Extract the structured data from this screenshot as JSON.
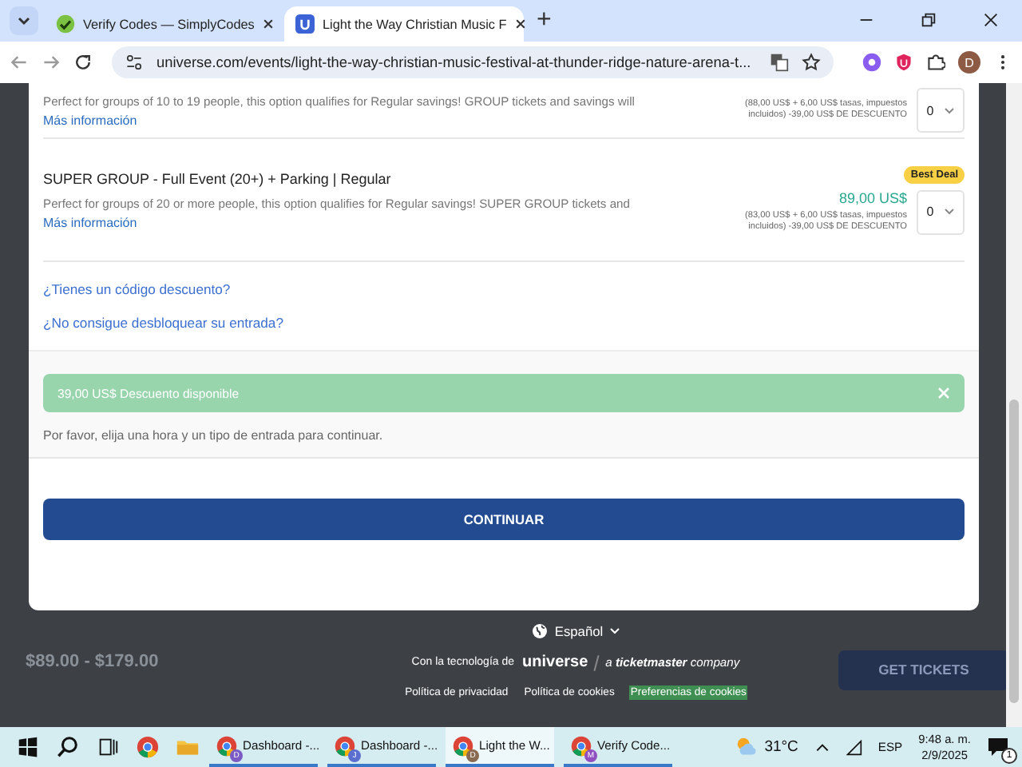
{
  "browser": {
    "tabs": [
      {
        "title": "Verify Codes — SimplyCodes",
        "selected": false
      },
      {
        "title": "Light the Way Christian Music F",
        "selected": true
      }
    ],
    "new_tab": "+",
    "url": "universe.com/events/light-the-way-christian-music-festival-at-thunder-ridge-nature-arena-t...",
    "profile": "D"
  },
  "tickets": [
    {
      "description": "Perfect for groups of 10 to 19 people, this option qualifies for Regular savings! GROUP tickets and savings will",
      "more_link": "Más información",
      "detail_lines": [
        "(88,00 US$ + 6,00 US$ tasas, impuestos",
        "incluidos) -39,00 US$ DE DESCUENTO"
      ],
      "quantity": "0"
    },
    {
      "title": "SUPER GROUP - Full Event (20+) + Parking | Regular",
      "description": "Perfect for groups of 20 or more people, this option qualifies for Regular savings! SUPER GROUP tickets and",
      "more_link": "Más información",
      "badge": "Best Deal",
      "price": "89,00 US$",
      "detail_lines": [
        "(83,00 US$ + 6,00 US$ tasas, impuestos",
        "incluidos) -39,00 US$ DE DESCUENTO"
      ],
      "quantity": "0"
    }
  ],
  "links": [
    "¿Tienes un código descuento?",
    "¿No consigue desbloquear su entrada?"
  ],
  "discount_banner": "39,00 US$ Descuento disponible",
  "notice": "Por favor, elija una hora y un tipo de entrada para continuar.",
  "continue_button": "CONTINUAR",
  "footer": {
    "language": "Español",
    "powered_by": "Con la tecnología de",
    "brand": "universe",
    "partner_prefix": "a",
    "partner": "ticketmaster",
    "partner_suffix": "company",
    "links": [
      {
        "label": "Política de privacidad",
        "highlighted": false
      },
      {
        "label": "Política de cookies",
        "highlighted": false
      },
      {
        "label": "Preferencias de cookies",
        "highlighted": true
      }
    ]
  },
  "price_range": "$89.00 - $179.00",
  "get_tickets_button": "GET TICKETS",
  "taskbar": {
    "windows": [
      {
        "label": "Dashboard -...",
        "avatar": "D",
        "color": "#7b5cc4",
        "selected": false
      },
      {
        "label": "Dashboard -...",
        "avatar": "J",
        "color": "#5b6fd0",
        "selected": false
      },
      {
        "label": "Light the W...",
        "avatar": "D",
        "color": "#8a6a50",
        "selected": true
      },
      {
        "label": "Verify Code...",
        "avatar": "M",
        "color": "#9050c0",
        "selected": false
      }
    ],
    "temperature": "31°C",
    "language": "ESP",
    "time": "9:48 a. m.",
    "date": "2/9/2025",
    "notifications": "1"
  }
}
